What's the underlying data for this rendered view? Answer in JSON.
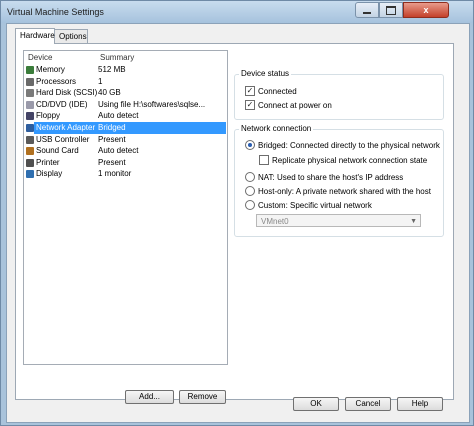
{
  "window": {
    "title": "Virtual Machine Settings"
  },
  "titlebar": {
    "minimize_icon": "minimize-icon",
    "maximize_icon": "maximize-icon",
    "close_glyph": "x"
  },
  "tabs": [
    {
      "label": "Hardware"
    },
    {
      "label": "Options"
    }
  ],
  "device_list": {
    "headers": {
      "device": "Device",
      "summary": "Summary"
    },
    "items": [
      {
        "device": "Memory",
        "summary": "512 MB",
        "icon": "memory-icon",
        "color": "#3b7d3b"
      },
      {
        "device": "Processors",
        "summary": "1",
        "icon": "processor-icon",
        "color": "#6a6a6a"
      },
      {
        "device": "Hard Disk (SCSI)",
        "summary": "40 GB",
        "icon": "hard-disk-icon",
        "color": "#7a7a7a"
      },
      {
        "device": "CD/DVD (IDE)",
        "summary": "Using file H:\\softwares\\sqlse...",
        "icon": "cd-dvd-icon",
        "color": "#9a9aaa"
      },
      {
        "device": "Floppy",
        "summary": "Auto detect",
        "icon": "floppy-icon",
        "color": "#444466"
      },
      {
        "device": "Network Adapter",
        "summary": "Bridged",
        "icon": "network-adapter-icon",
        "color": "#2f5f9f",
        "selected": true
      },
      {
        "device": "USB Controller",
        "summary": "Present",
        "icon": "usb-icon",
        "color": "#5a5a5a"
      },
      {
        "device": "Sound Card",
        "summary": "Auto detect",
        "icon": "sound-card-icon",
        "color": "#b07020"
      },
      {
        "device": "Printer",
        "summary": "Present",
        "icon": "printer-icon",
        "color": "#505050"
      },
      {
        "device": "Display",
        "summary": "1 monitor",
        "icon": "display-icon",
        "color": "#2f6fb0"
      }
    ]
  },
  "buttons": {
    "add": "Add...",
    "remove": "Remove",
    "ok": "OK",
    "cancel": "Cancel",
    "help": "Help"
  },
  "device_status": {
    "title": "Device status",
    "connected": {
      "label": "Connected",
      "checked": true
    },
    "connect_at_power_on": {
      "label": "Connect at power on",
      "checked": true
    }
  },
  "network_connection": {
    "title": "Network connection",
    "bridged": {
      "label": "Bridged: Connected directly to the physical network",
      "selected": true
    },
    "replicate": {
      "label": "Replicate physical network connection state",
      "checked": false
    },
    "nat": {
      "label": "NAT: Used to share the host's IP address",
      "selected": false
    },
    "host_only": {
      "label": "Host-only: A private network shared with the host",
      "selected": false
    },
    "custom": {
      "label": "Custom: Specific virtual network",
      "selected": false
    },
    "vmnet_select": {
      "value": "VMnet0"
    }
  },
  "colors": {
    "selection": "#3399ff",
    "title_gradient_top": "#c8dcee",
    "close_button": "#c4402a"
  }
}
